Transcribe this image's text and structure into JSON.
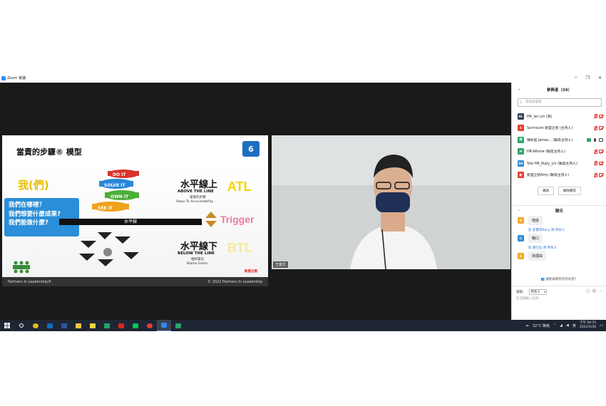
{
  "window": {
    "title": "Zoom 會議",
    "controls": [
      "─",
      "❐",
      "✕"
    ]
  },
  "slide": {
    "title": "當責的步驟® 模型",
    "number": "6",
    "wo": "我(們)",
    "questions": [
      "我們在哪裡？",
      "我們想要什麼成果?",
      "我們能做什麼?"
    ],
    "horizontal_line": "水平線",
    "steps": [
      "DO IT",
      "SOLVE IT",
      "OWN IT",
      "SEE IT"
    ],
    "above": {
      "zh": "水平線上",
      "en": "ABOVE THE LINE",
      "zh_sub": "當責的步驟",
      "steps_text": "Steps To Accountability"
    },
    "atl": "ATL",
    "trigger": "Trigger",
    "below": {
      "zh": "水平線下",
      "en": "BELOW THE LINE",
      "zh_sub": "推卸責任",
      "blame": "Blame Game"
    },
    "btl": "BTL",
    "brand": "新盟企管",
    "footer_left": "Partners In Leadership®",
    "footer_right": "© 2022 Partners In Leadership"
  },
  "video": {
    "name_tag": "王俊文"
  },
  "participants": {
    "header": "參與者（39）",
    "search_placeholder": "尋找與會者",
    "list": [
      {
        "initials": "HL",
        "name": "HR_Ian Lin (我)",
        "color": "#2d3e55"
      },
      {
        "initials": "S",
        "name": "Surmount 新盟企管 (主持人)",
        "color": "#e33b2e"
      },
      {
        "initials": "陳",
        "name": "陳依庭 James... (聯席主持人)",
        "color": "#2ea36a"
      },
      {
        "initials": "H",
        "name": "HR-Winnie (聯席主持人)",
        "color": "#2ea36a"
      },
      {
        "initials": "SH",
        "name": "Site HR_Ruby_Lin (聯席主持人)",
        "color": "#2d8cd6"
      },
      {
        "initials": "新",
        "name": "新盟企管Amy (聯席主持人)",
        "color": "#e33b2e"
      }
    ],
    "invite_label": "邀請",
    "unmute_all_label": "解除靜音"
  },
  "chat": {
    "header": "聊天",
    "messages": [
      {
        "sender": "",
        "avatar": "楊",
        "text": "拖延"
      },
      {
        "sender": "從 彭憲萍Rony 到 所有人",
        "avatar": "彭",
        "text": "藉口"
      },
      {
        "sender": "從 黃仕弘 到 所有人",
        "avatar": "黃",
        "text": "找理由"
      }
    ],
    "unread_label": "誰能與看到您的訊息？",
    "send_to_label": "發給：",
    "send_to_value": "所有人",
    "input_placeholder": "在這裡輸入訊息..."
  },
  "taskbar": {
    "weather": "32°C  陣雨",
    "ime": "英",
    "time": "下午 04:31",
    "date": "2022/5/30",
    "apps": [
      {
        "name": "search-icon",
        "color": "#ffffff"
      },
      {
        "name": "chrome-icon",
        "color": "#e9b923"
      },
      {
        "name": "outlook-icon",
        "color": "#0f6cbd"
      },
      {
        "name": "word-icon",
        "color": "#2b579a"
      },
      {
        "name": "file-explorer-icon",
        "color": "#f5c242"
      },
      {
        "name": "sticky-notes-icon",
        "color": "#f8d33c"
      },
      {
        "name": "excel-icon",
        "color": "#21a366"
      },
      {
        "name": "acrobat-icon",
        "color": "#d6281e"
      },
      {
        "name": "line-icon",
        "color": "#06c755"
      },
      {
        "name": "chrome-icon-2",
        "color": "#e34133"
      },
      {
        "name": "zoom-icon",
        "color": "#2d8cff"
      },
      {
        "name": "app-icon",
        "color": "#2ea36a"
      }
    ]
  }
}
